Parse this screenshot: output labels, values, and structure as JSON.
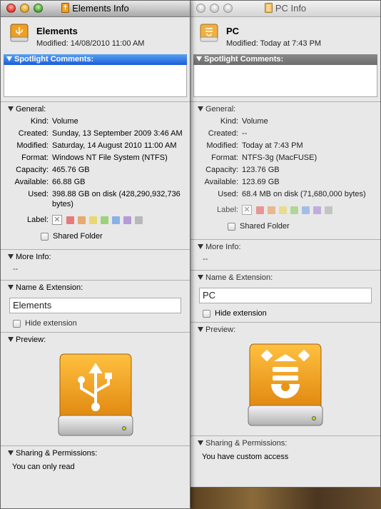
{
  "colors": {
    "drive_orange": "#f0a020",
    "spotlight_active": "#1a5ed8",
    "spotlight_inactive": "#737373"
  },
  "win1": {
    "title": "Elements Info",
    "name": "Elements",
    "modified": "Modified:  14/08/2010 11:00 AM",
    "spotlight": "Spotlight Comments:",
    "general": {
      "head": "General:",
      "kind_k": "Kind:",
      "kind_v": "Volume",
      "created_k": "Created:",
      "created_v": "Sunday, 13 September 2009 3:46 AM",
      "modified_k": "Modified:",
      "modified_v": "Saturday, 14 August 2010 11:00 AM",
      "format_k": "Format:",
      "format_v": "Windows NT File System (NTFS)",
      "capacity_k": "Capacity:",
      "capacity_v": "465.76 GB",
      "available_k": "Available:",
      "available_v": "66.88 GB",
      "used_k": "Used:",
      "used_v": "398.88 GB on disk (428,290,932,736 bytes)",
      "label_k": "Label:",
      "shared": "Shared Folder"
    },
    "more_info": {
      "head": "More Info:",
      "value": "--"
    },
    "name_ext": {
      "head": "Name & Extension:",
      "field": "Elements",
      "hide": "Hide extension"
    },
    "preview": {
      "head": "Preview:",
      "icon": "usb-drive-icon"
    },
    "sharing": {
      "head": "Sharing & Permissions:",
      "value": "You can only read"
    }
  },
  "win2": {
    "title": "PC Info",
    "name": "PC",
    "modified": "Modified:  Today at 7:43 PM",
    "spotlight": "Spotlight Comments:",
    "general": {
      "head": "General:",
      "kind_k": "Kind:",
      "kind_v": "Volume",
      "created_k": "Created:",
      "created_v": "--",
      "modified_k": "Modified:",
      "modified_v": "Today at 7:43 PM",
      "format_k": "Format:",
      "format_v": "NTFS-3g (MacFUSE)",
      "capacity_k": "Capacity:",
      "capacity_v": "123.76 GB",
      "available_k": "Available:",
      "available_v": "123.69 GB",
      "used_k": "Used:",
      "used_v": "68.4 MB on disk (71,680,000 bytes)",
      "label_k": "Label:",
      "shared": "Shared Folder"
    },
    "more_info": {
      "head": "More Info:",
      "value": "--"
    },
    "name_ext": {
      "head": "Name & Extension:",
      "field": "PC",
      "hide": "Hide extension"
    },
    "preview": {
      "head": "Preview:",
      "icon": "firewire-drive-icon"
    },
    "sharing": {
      "head": "Sharing & Permissions:",
      "value": "You have custom access"
    }
  },
  "label_swatches": [
    "#e87a7a",
    "#e8a870",
    "#e8d870",
    "#9cd27a",
    "#8ab0e8",
    "#b49ad8",
    "#b8b8b8"
  ]
}
